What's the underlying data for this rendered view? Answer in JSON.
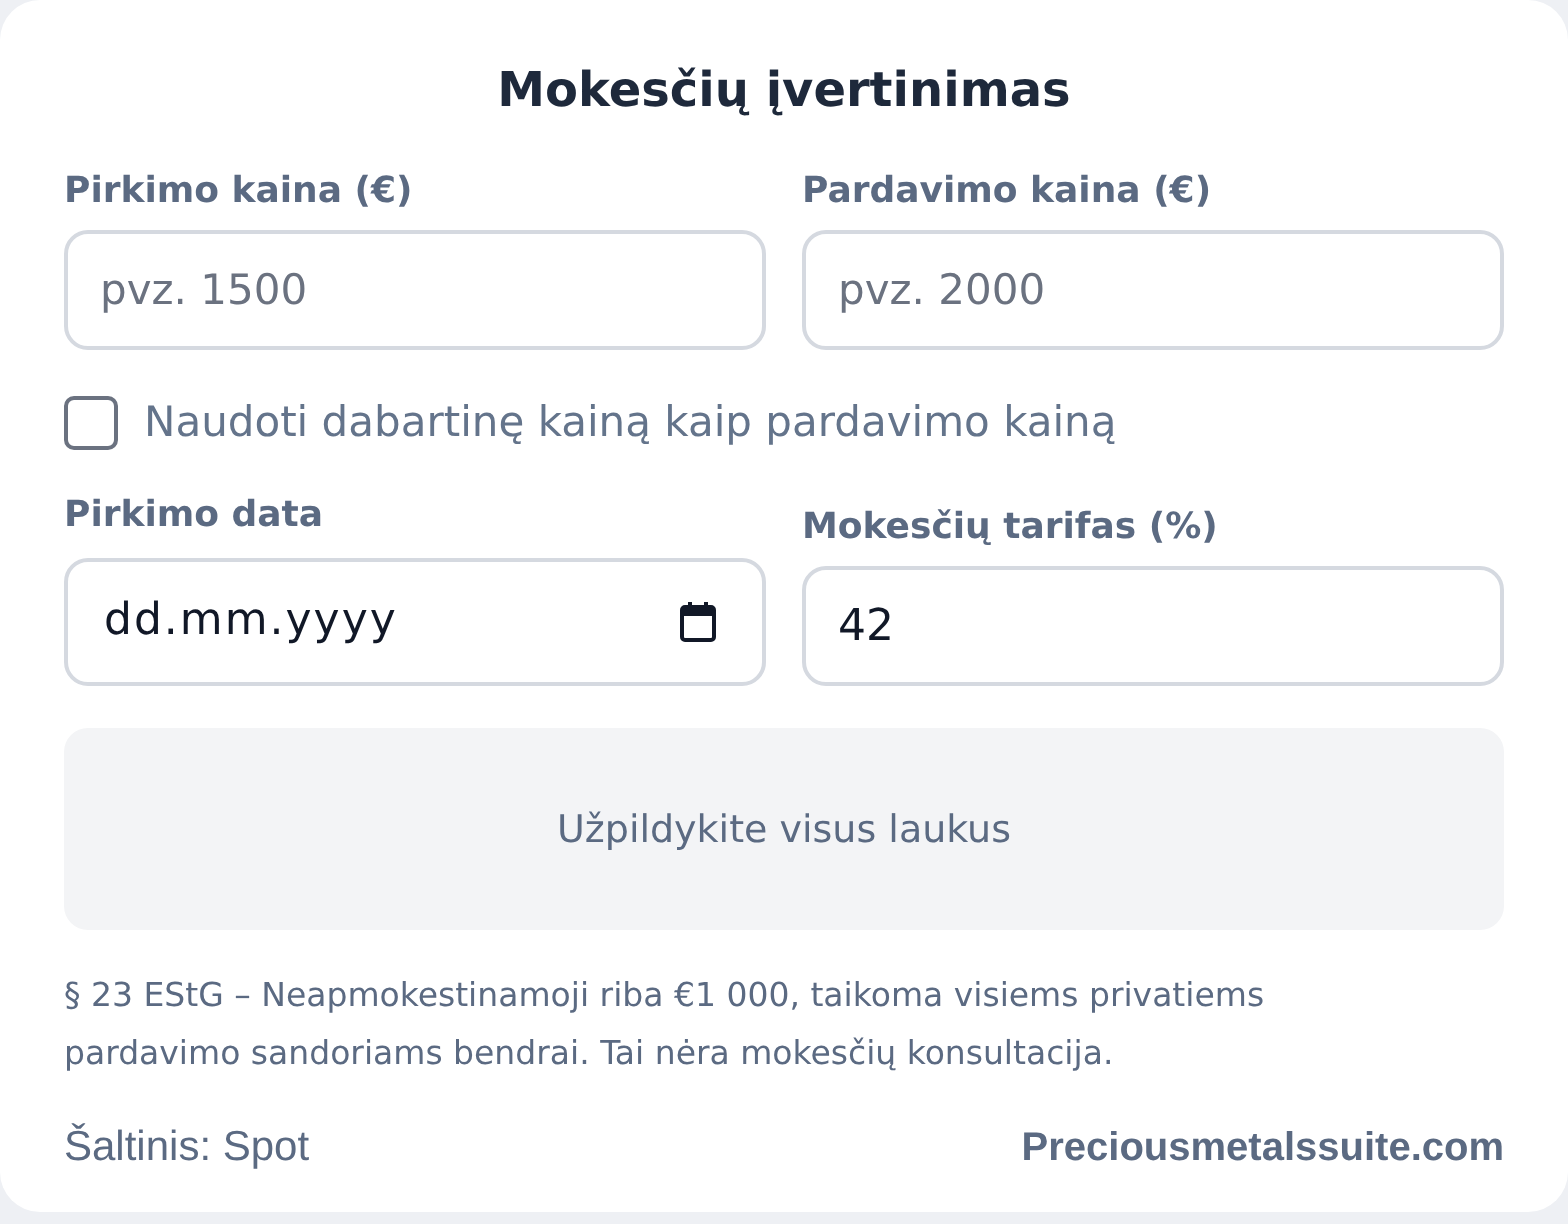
{
  "title": "Mokesčių įvertinimas",
  "price_fields": [
    {
      "label": "Pirkimo kaina (€)",
      "placeholder": "pvz. 1500"
    },
    {
      "label": "Pardavimo kaina (€)",
      "placeholder": "pvz. 2000"
    }
  ],
  "checkbox": {
    "label": "Naudoti dabartinę kainą kaip pardavimo kainą",
    "checked": false
  },
  "detail_fields": [
    {
      "kind": "date",
      "label": "Pirkimo data",
      "placeholder": "dd.mm.yyyy"
    },
    {
      "kind": "number",
      "label": "Mokesčių tarifas (%)",
      "value": "42"
    }
  ],
  "result": {
    "message": "Užpildykite visus laukus"
  },
  "disclaimer": "§ 23 EStG – Neapmokestinamoji riba €1 000, taikoma visiems privatiems pardavimo sandoriams bendrai. Tai nėra mokesčių konsultacija.",
  "footer": {
    "source": "Šaltinis: Spot",
    "brand": "Preciousmetalssuite.com"
  }
}
